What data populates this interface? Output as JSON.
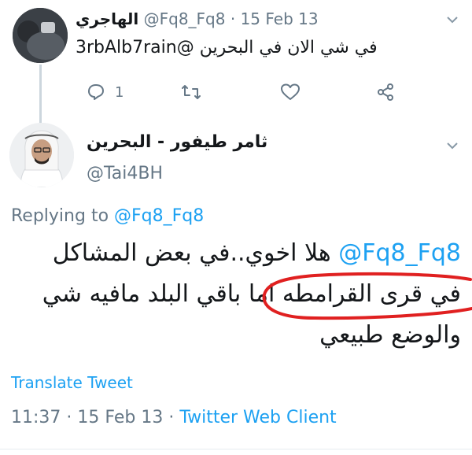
{
  "reply_tweet": {
    "display_name": "الهاجري",
    "handle": "@Fq8_Fq8",
    "separator": "·",
    "date": "15 Feb 13",
    "text": "3rbAlb7rain@ في شي الان في البحرين",
    "reply_count": "1"
  },
  "main_tweet": {
    "display_name": "ثامر طيفور - البحرين",
    "handle": "@Tai4BH",
    "replying_prefix": "Replying to ",
    "replying_to": "@Fq8_Fq8",
    "mention": "@Fq8_Fq8",
    "body_line1": "هلا اخوي..في بعض المشاكل",
    "body_line2": "في قرى القرامطه اما باقي البلد مافيه شي",
    "body_line3": "والوضع طبيعي",
    "translate_label": "Translate Tweet",
    "time": "11:37",
    "date": "15 Feb 13",
    "client": "Twitter Web Client"
  },
  "colors": {
    "link": "#1da1f2",
    "secondary": "#657786",
    "annotation": "#e02020"
  },
  "icons": [
    "reply-icon",
    "retweet-icon",
    "like-icon",
    "share-icon",
    "chevron-down-icon"
  ]
}
